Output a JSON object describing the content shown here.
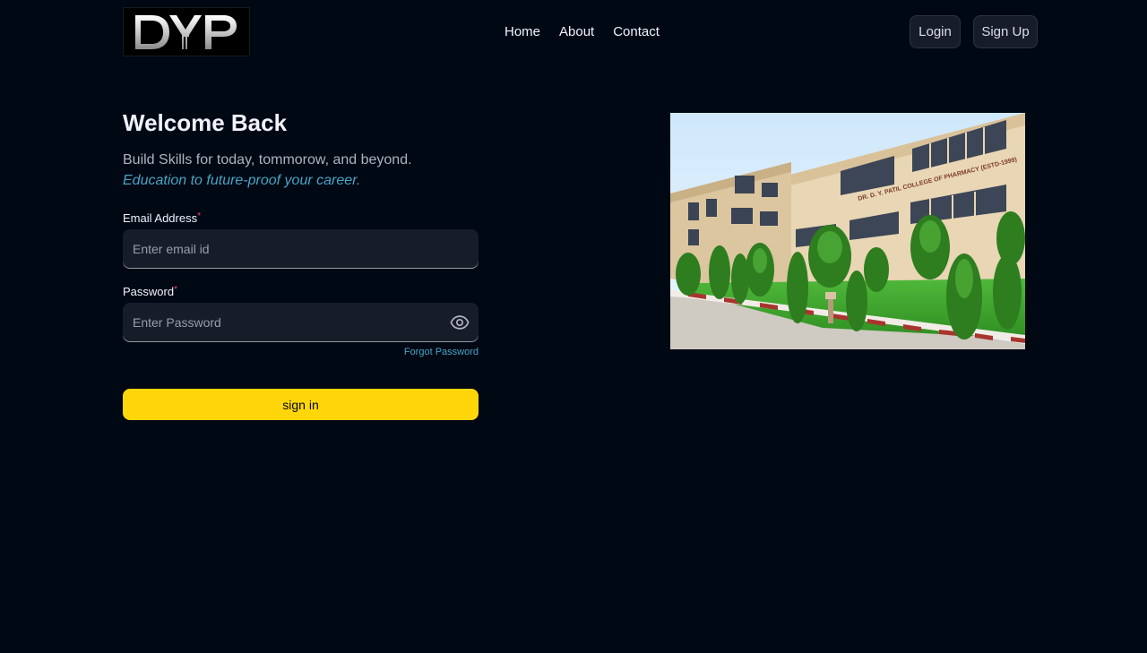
{
  "nav": {
    "logo_text": "DYP",
    "links": [
      "Home",
      "About",
      "Contact"
    ],
    "login_label": "Login",
    "signup_label": "Sign Up"
  },
  "form": {
    "title": "Welcome Back",
    "subtitle": "Build Skills for today, tommorow, and beyond.",
    "tagline": "Education to future-proof your career.",
    "email_label": "Email Address",
    "email_placeholder": "Enter email id",
    "password_label": "Password",
    "password_placeholder": "Enter Password",
    "required_mark": "*",
    "forgot_label": "Forgot Password",
    "submit_label": "sign in"
  },
  "photo": {
    "building_sign": "DR. D. Y. PATIL COLLEGE OF PHARMACY (ESTD-1999)"
  },
  "colors": {
    "background": "#000814",
    "accent_yellow": "#ffd60a",
    "link_blue": "#47a5c5",
    "required_red": "#ef476f"
  },
  "icons": {
    "password_toggle": "eye-icon"
  }
}
